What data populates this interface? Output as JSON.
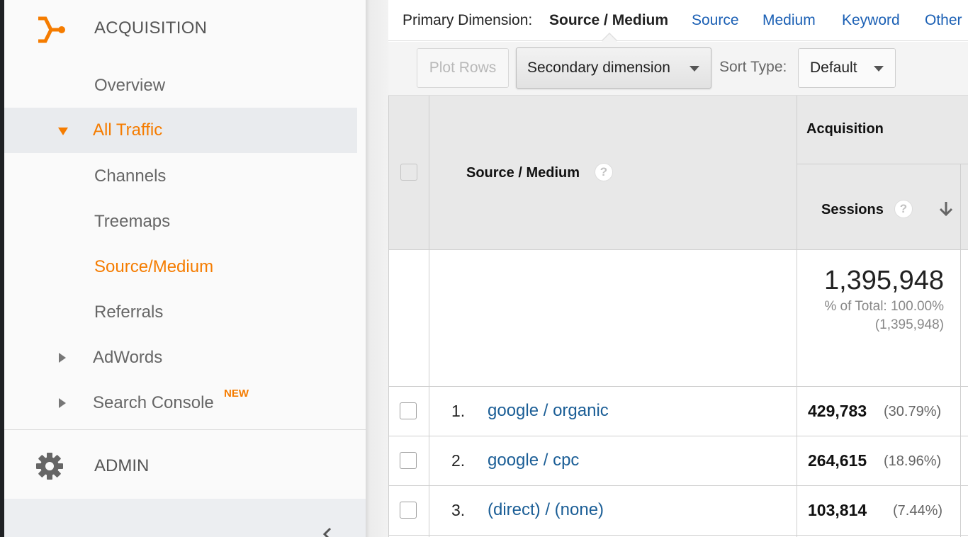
{
  "sidebar": {
    "section_title": "ACQUISITION",
    "items": [
      {
        "label": "Overview"
      },
      {
        "label": "All Traffic"
      },
      {
        "label": "Channels"
      },
      {
        "label": "Treemaps"
      },
      {
        "label": "Source/Medium"
      },
      {
        "label": "Referrals"
      },
      {
        "label": "AdWords"
      },
      {
        "label": "Search Console",
        "badge": "NEW"
      }
    ],
    "admin_label": "ADMIN"
  },
  "primary_dimension": {
    "label": "Primary Dimension:",
    "current": "Source / Medium",
    "options": [
      "Source",
      "Medium",
      "Keyword",
      "Other"
    ]
  },
  "toolbar": {
    "plot_rows_label": "Plot Rows",
    "secondary_dimension_label": "Secondary dimension",
    "sort_type_label": "Sort Type:",
    "sort_type_value": "Default"
  },
  "table": {
    "dimension_header": "Source / Medium",
    "group_header": "Acquisition",
    "metric_header": "Sessions",
    "help_glyph": "?",
    "totals": {
      "value": "1,395,948",
      "pct_label": "% of Total: 100.00%",
      "pct_base": "(1,395,948)"
    },
    "rows": [
      {
        "num": "1.",
        "source_medium": "google / organic",
        "sessions": "429,783",
        "pct": "(30.79%)"
      },
      {
        "num": "2.",
        "source_medium": "google / cpc",
        "sessions": "264,615",
        "pct": "(18.96%)"
      },
      {
        "num": "3.",
        "source_medium": "(direct) / (none)",
        "sessions": "103,814",
        "pct": "(7.44%)"
      }
    ]
  },
  "colors": {
    "accent_orange": "#f57c00",
    "link_blue": "#1b5e96"
  }
}
